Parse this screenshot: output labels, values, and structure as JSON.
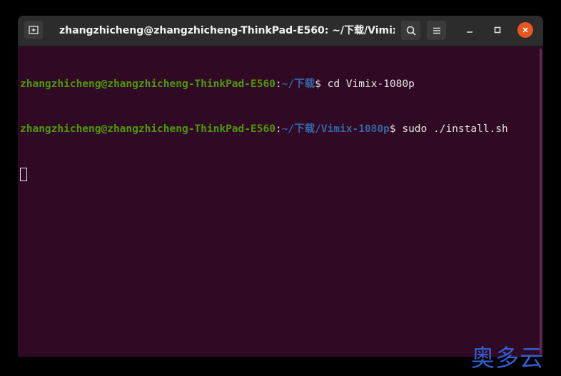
{
  "window": {
    "title": "zhangzhicheng@zhangzhicheng-ThinkPad-E560: ~/下载/Vimix-1..."
  },
  "titlebar": {
    "new_tab_icon": "new-tab-icon",
    "search_icon": "search-icon",
    "menu_icon": "hamburger-menu-icon",
    "minimize_icon": "minimize-icon",
    "maximize_icon": "maximize-icon",
    "close_icon": "close-icon"
  },
  "terminal": {
    "lines": [
      {
        "user": "zhangzhicheng@zhangzhicheng-ThinkPad-E560",
        "sep": ":",
        "path": "~/下载",
        "prompt": "$ ",
        "command": "cd Vimix-1080p"
      },
      {
        "user": "zhangzhicheng@zhangzhicheng-ThinkPad-E560",
        "sep": ":",
        "path": "~/下载/Vimix-1080p",
        "prompt": "$ ",
        "command": "sudo ./install.sh"
      }
    ]
  },
  "watermark": {
    "text": "奥多云"
  },
  "colors": {
    "terminal_bg": "#300a24",
    "titlebar_bg": "#2c2c2c",
    "user_green": "#4e9a06",
    "path_blue": "#3465a4",
    "close_orange": "#e95420",
    "watermark_blue": "#2f5fd0"
  }
}
